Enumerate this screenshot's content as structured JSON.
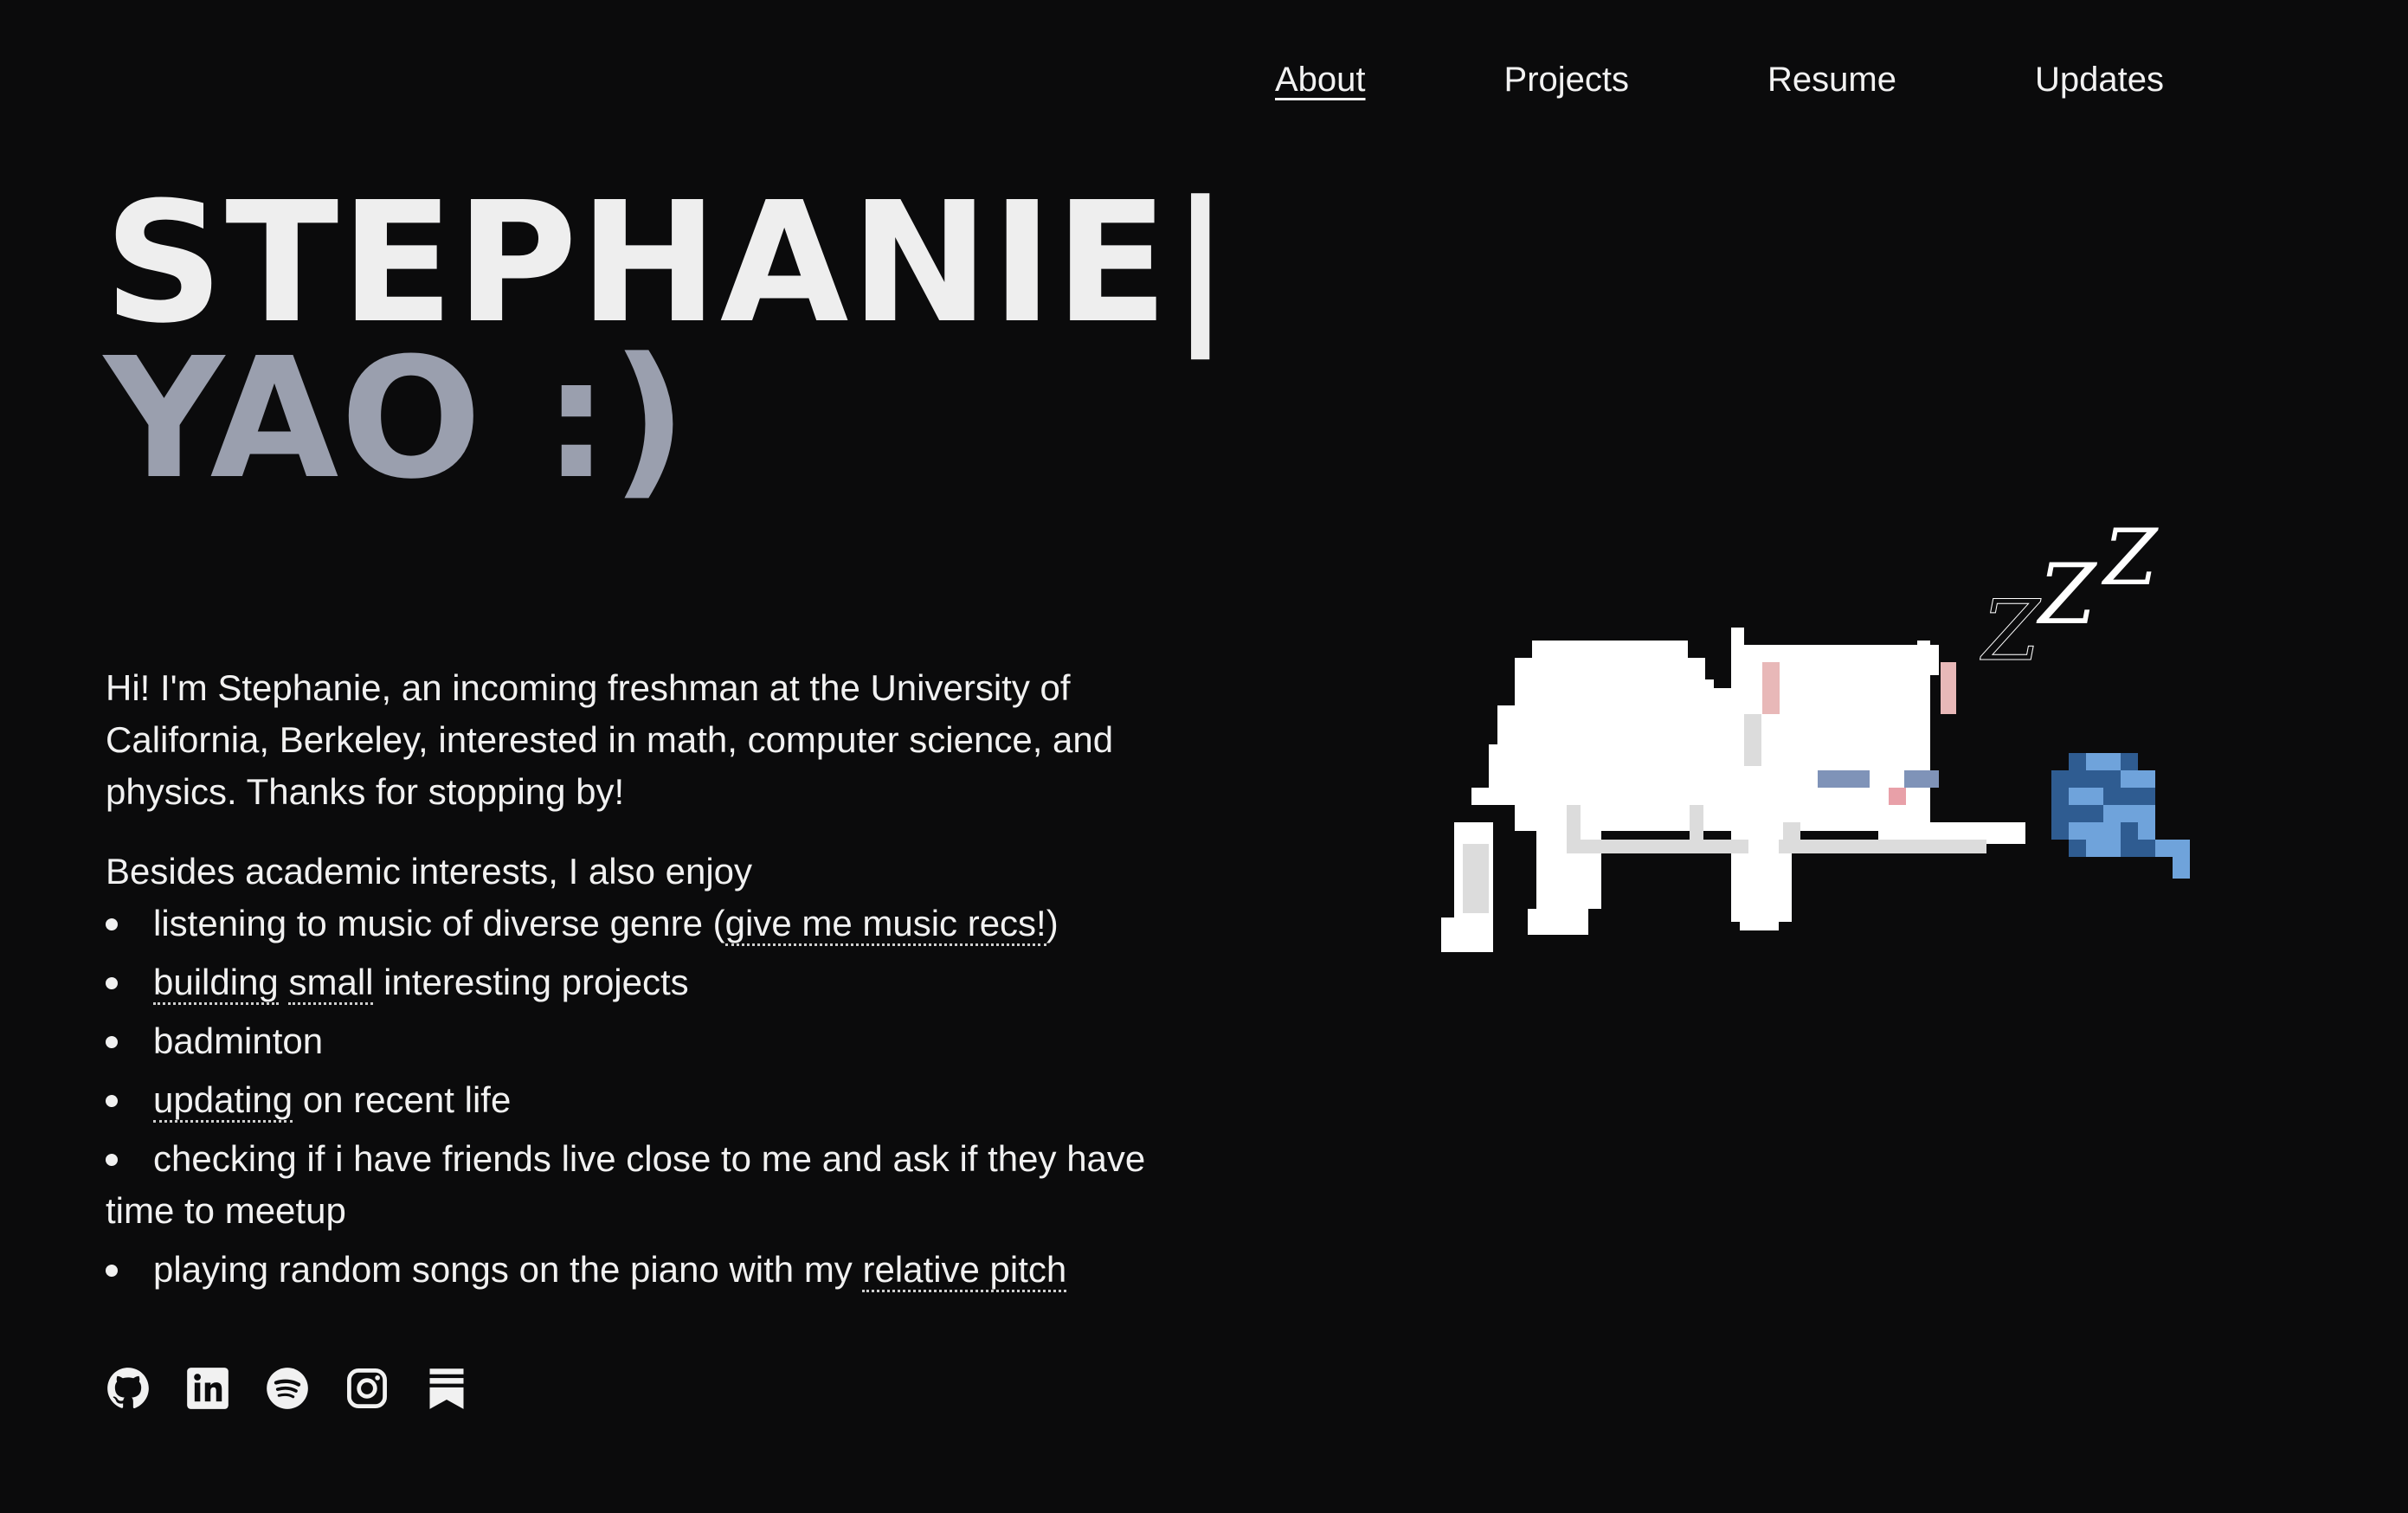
{
  "nav": {
    "items": [
      {
        "label": "About",
        "active": true
      },
      {
        "label": "Projects",
        "active": false
      },
      {
        "label": "Resume",
        "active": false
      },
      {
        "label": "Updates",
        "active": false
      }
    ]
  },
  "hero": {
    "line1": "STEPHANIE|",
    "line2": "YAO :)"
  },
  "intro": {
    "paragraph": "Hi! I'm Stephanie, an incoming freshman at the University of California, Berkeley, interested in math, computer science, and physics. Thanks for stopping by!",
    "lead": "Besides academic interests, I also enjoy"
  },
  "interests": {
    "item1_pre": "listening to music of diverse genre (",
    "item1_link": "give me music recs!",
    "item1_post": ")",
    "item2_link_a": "building",
    "item2_link_b": "small",
    "item2_post": " interesting projects",
    "item3": "badminton",
    "item4_link": "updating",
    "item4_post": " on recent life",
    "item5": "checking if i have friends live close to me and ask if they have time to meetup",
    "item6_pre": "playing random songs on the piano with my ",
    "item6_link": "relative pitch"
  },
  "socials": {
    "icons": [
      "github-icon",
      "linkedin-icon",
      "spotify-icon",
      "instagram-icon",
      "substack-icon"
    ]
  },
  "illustration": {
    "sleep_text": "zZZ",
    "colors": {
      "background": "#0b0b0c",
      "cat_body": "#ffffff",
      "cat_shadow": "#dcdcdc",
      "ear_inner": "#e8b8b8",
      "eyes": "#7f93b8",
      "nose": "#e8a0a8",
      "yarn_dark": "#2f5c91",
      "yarn_light": "#6fa3db"
    }
  }
}
